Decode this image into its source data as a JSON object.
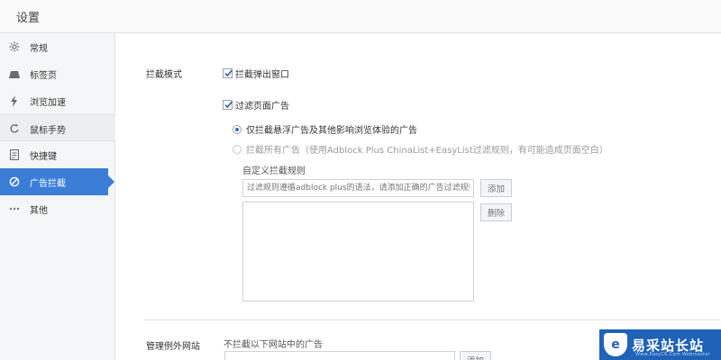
{
  "window": {
    "title": "设置"
  },
  "sidebar": {
    "items": [
      {
        "label": "常规",
        "icon": "gear-icon"
      },
      {
        "label": "标签页",
        "icon": "tab-icon"
      },
      {
        "label": "浏览加速",
        "icon": "lightning-icon"
      },
      {
        "label": "鼠标手势",
        "icon": "mouse-gesture-icon"
      },
      {
        "label": "快捷键",
        "icon": "keyboard-icon"
      },
      {
        "label": "广告拦截",
        "icon": "block-icon"
      },
      {
        "label": "其他",
        "icon": "more-icon"
      }
    ],
    "active_index": 5,
    "active_color": "#3b7ed8"
  },
  "adblock": {
    "mode_label": "拦截模式",
    "block_popup": {
      "label": "拦截弹出窗口",
      "checked": true
    },
    "filter_ads": {
      "label": "过滤页面广告",
      "checked": true
    },
    "radio_options": [
      {
        "label": "仅拦截悬浮广告及其他影响浏览体验的广告",
        "selected": true
      },
      {
        "label": "拦截所有广告（使用Adblock Plus ChinaList+EasyList过滤规则，有可能造成页面空白）",
        "selected": false
      }
    ],
    "custom_rules_label": "自定义拦截规则",
    "rule_input_placeholder": "过滤规则遵循adblock plus的语法，请添加正确的广告过滤规则",
    "add_button": "添加",
    "delete_button": "删除"
  },
  "exceptions": {
    "section_label": "管理例外网站",
    "sub_label": "不拦截以下网站中的广告",
    "add_button": "添加"
  },
  "watermark": {
    "brand_text": "易采站长站",
    "url_text": "Www.EasyCK.Com  Webmaster"
  }
}
